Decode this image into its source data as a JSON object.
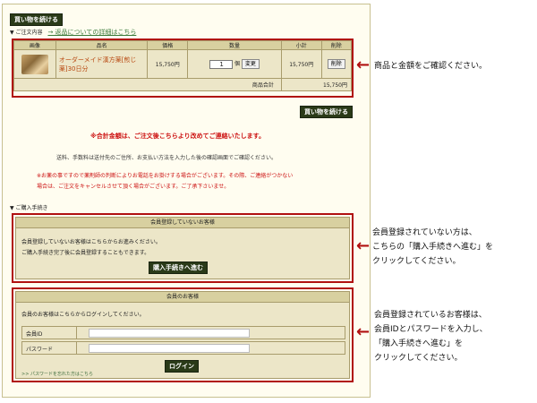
{
  "top_button": "買い物を続ける",
  "order_section": {
    "title": "▼ ご注文内容",
    "return_link": "→ 返品についての詳細はこちら"
  },
  "cart": {
    "headers": [
      "画像",
      "品名",
      "価格",
      "数量",
      "小計",
      "削除"
    ],
    "item": {
      "name": "オーダーメイド漢方薬[煎じ薬]30日分",
      "price": "15,750円",
      "quantity": "1",
      "unit": "個",
      "change_button": "変更",
      "subtotal": "15,750円",
      "delete_button": "削除"
    },
    "total_label": "商品合計",
    "total_value": "15,750円"
  },
  "continue_button": "買い物を続ける",
  "notes": {
    "total_notice": "※合計金額は、ご注文後こちらより改めてご連絡いたします。",
    "shipping_notice": "送料、手数料は送付先のご住所、お支払い方法を入力した後の確認画面でご確認ください。",
    "medicine_notice_1": "※お薬の事ですので薬剤師の判断によりお電話をお掛けする場合がございます。その際、ご連絡がつかない",
    "medicine_notice_2": "場合は、ご注文をキャンセルさせて頂く場合がございます。ご了承下さいませ。"
  },
  "purchase_section": {
    "title": "▼ ご購入手続き"
  },
  "guest_panel": {
    "title": "会員登録していないお客様",
    "line1": "会員登録していないお客様はこちらからお進みください。",
    "line2": "ご購入手続き完了後に会員登録することもできます。",
    "button": "購入手続きへ進む"
  },
  "member_panel": {
    "title": "会員のお客様",
    "line1": "会員のお客様はこちらからログインしてください。",
    "id_label": "会員ID",
    "password_label": "パスワード",
    "login_button": "ログイン",
    "forgot_link": ">> パスワードを忘れた方はこちら"
  },
  "callouts": {
    "c1": "商品と金額をご確認ください。",
    "c2_line1": "会員登録されていない方は、",
    "c2_line2": "こちらの「購入手続きへ進む」を",
    "c2_line3": "クリックしてください。",
    "c3_line1": "会員登録されているお客様は、",
    "c3_line2": "会員IDとパスワードを入力し、",
    "c3_line3": "「購入手続きへ進む」を",
    "c3_line4": "クリックしてください。"
  },
  "colors": {
    "accent_red": "#b01010",
    "panel_bg": "#ece6c8",
    "header_bg": "#d8d0a0",
    "button_dark": "#2a3a18"
  }
}
